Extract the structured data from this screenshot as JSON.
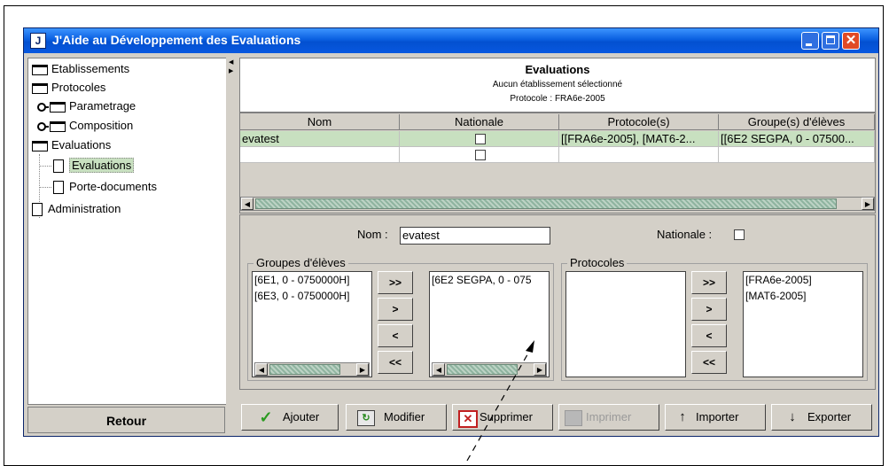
{
  "window": {
    "title": "J'Aide au Développement des Evaluations",
    "app_icon": "J"
  },
  "tree": {
    "items": [
      {
        "label": "Etablissements",
        "icon": "folder-icon"
      },
      {
        "label": "Protocoles",
        "icon": "folder-icon"
      },
      {
        "label": "Parametrage",
        "icon": "folder-icon"
      },
      {
        "label": "Composition",
        "icon": "folder-icon"
      },
      {
        "label": "Evaluations",
        "icon": "folder-icon"
      },
      {
        "label": "Evaluations",
        "icon": "document-icon",
        "selected": true
      },
      {
        "label": "Porte-documents",
        "icon": "document-icon"
      },
      {
        "label": "Administration",
        "icon": "document-icon"
      }
    ],
    "back_button": "Retour"
  },
  "header": {
    "title": "Evaluations",
    "subtitle": "Aucun établissement sélectionné",
    "protocol": "Protocole : FRA6e-2005"
  },
  "table": {
    "columns": [
      "Nom",
      "Nationale",
      "Protocole(s)",
      "Groupe(s) d'élèves"
    ],
    "rows": [
      {
        "nom": "evatest",
        "nationale": false,
        "protocoles": "[[FRA6e-2005], [MAT6-2...",
        "groupes": "[[6E2 SEGPA, 0 - 07500..."
      },
      {
        "nom": "",
        "nationale": false,
        "protocoles": "",
        "groupes": ""
      }
    ]
  },
  "form": {
    "nom_label": "Nom :",
    "nom_value": "evatest",
    "nationale_label": "Nationale :",
    "nationale_checked": false,
    "groupes": {
      "title": "Groupes d'élèves",
      "available": [
        "[6E1, 0 - 0750000H]",
        "[6E3, 0 - 0750000H]"
      ],
      "selected": [
        "[6E2 SEGPA, 0 - 075"
      ]
    },
    "protocoles": {
      "title": "Protocoles",
      "available": [],
      "selected": [
        "[FRA6e-2005]",
        "[MAT6-2005]"
      ]
    },
    "move_buttons": [
      ">>",
      ">",
      "<",
      "<<"
    ]
  },
  "actions": {
    "ajouter": "Ajouter",
    "modifier": "Modifier",
    "supprimer": "Supprimer",
    "imprimer": "Imprimer",
    "importer": "Importer",
    "exporter": "Exporter"
  },
  "colors": {
    "titlebar": "#0a5fe0",
    "selected_row": "#c8e0c0",
    "window_bg": "#d4d0c8",
    "close_button": "#e04a26"
  }
}
